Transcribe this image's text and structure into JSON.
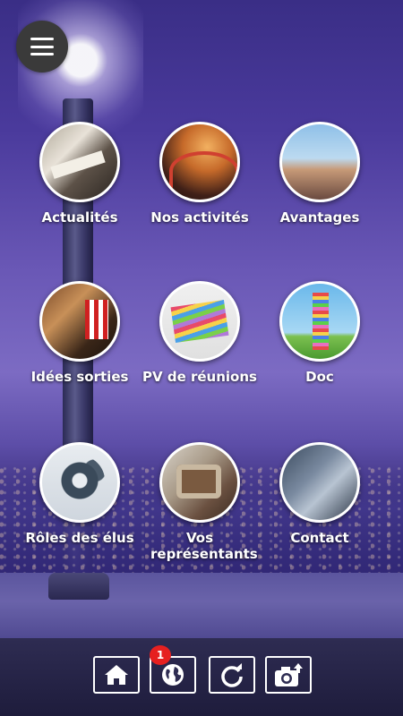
{
  "menu": {
    "icon": "hamburger-menu-icon"
  },
  "tiles": [
    {
      "label": "Actualités",
      "image": "newspaper-photo"
    },
    {
      "label": "Nos activités",
      "image": "rollercoaster-photo"
    },
    {
      "label": "Avantages",
      "image": "family-castle-photo"
    },
    {
      "label": "Idées sorties",
      "image": "cinema-popcorn-photo"
    },
    {
      "label": "PV de réunions",
      "image": "books-stack-photo"
    },
    {
      "label": "Doc",
      "image": "book-tower-photo"
    },
    {
      "label": "Rôles des élus",
      "image": "gears-people-photo"
    },
    {
      "label": "Vos représentants",
      "image": "meeting-table-photo"
    },
    {
      "label": "Contact",
      "image": "touchscreen-photo"
    }
  ],
  "bottom_nav": {
    "home": {
      "icon": "home-icon"
    },
    "globe": {
      "icon": "globe-icon",
      "badge": "1"
    },
    "refresh": {
      "icon": "refresh-icon"
    },
    "camera": {
      "icon": "camera-upload-icon"
    }
  },
  "colors": {
    "badge": "#e62020",
    "label": "#ffffff",
    "bar": "#1e1c3c"
  }
}
